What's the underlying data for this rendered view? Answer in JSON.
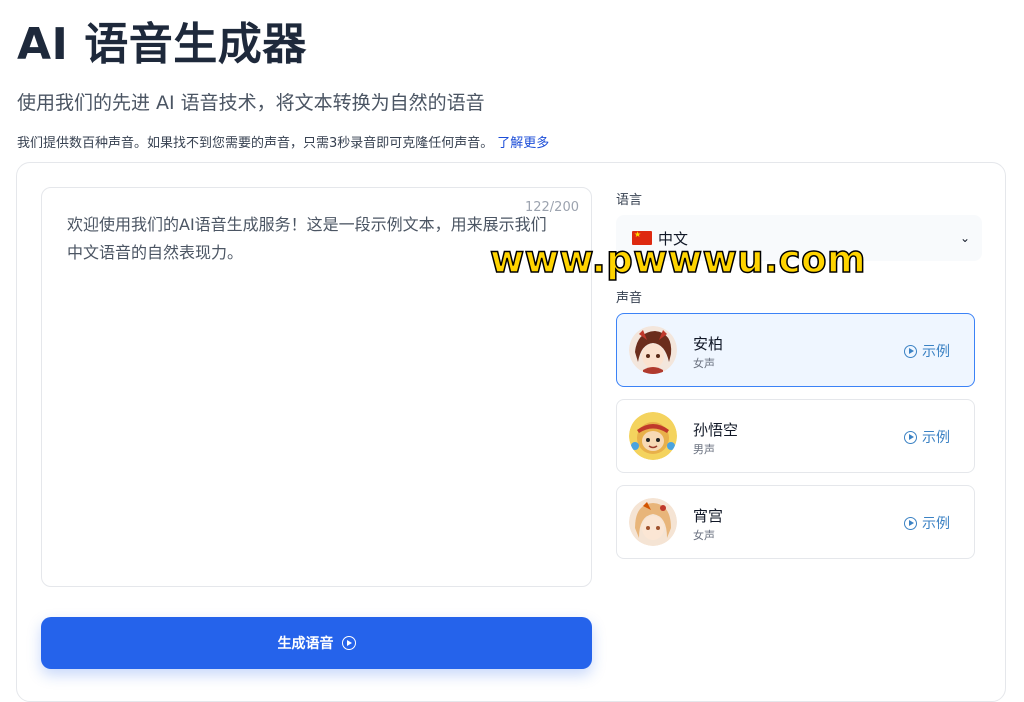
{
  "header": {
    "title": "AI 语音生成器",
    "subtitle": "使用我们的先进 AI 语音技术，将文本转换为自然的语音",
    "note": "我们提供数百种声音。如果找不到您需要的声音，只需3秒录音即可克隆任何声音。",
    "learn_more": "了解更多"
  },
  "editor": {
    "text": "欢迎使用我们的AI语音生成服务！这是一段示例文本，用来展示我们中文语音的自然表现力。",
    "char_count": "122/200"
  },
  "generate_button": {
    "label": "生成语音"
  },
  "language": {
    "label": "语言",
    "selected": "中文"
  },
  "voices": {
    "label": "声音",
    "items": [
      {
        "name": "安柏",
        "gender": "女声",
        "sample": "示例",
        "selected": true
      },
      {
        "name": "孙悟空",
        "gender": "男声",
        "sample": "示例",
        "selected": false
      },
      {
        "name": "宵宫",
        "gender": "女声",
        "sample": "示例",
        "selected": false
      }
    ]
  },
  "watermark": "www.pwwwu.com",
  "colors": {
    "accent": "#2563eb",
    "selected_bg": "#eff6ff",
    "selected_border": "#3b82f6"
  }
}
